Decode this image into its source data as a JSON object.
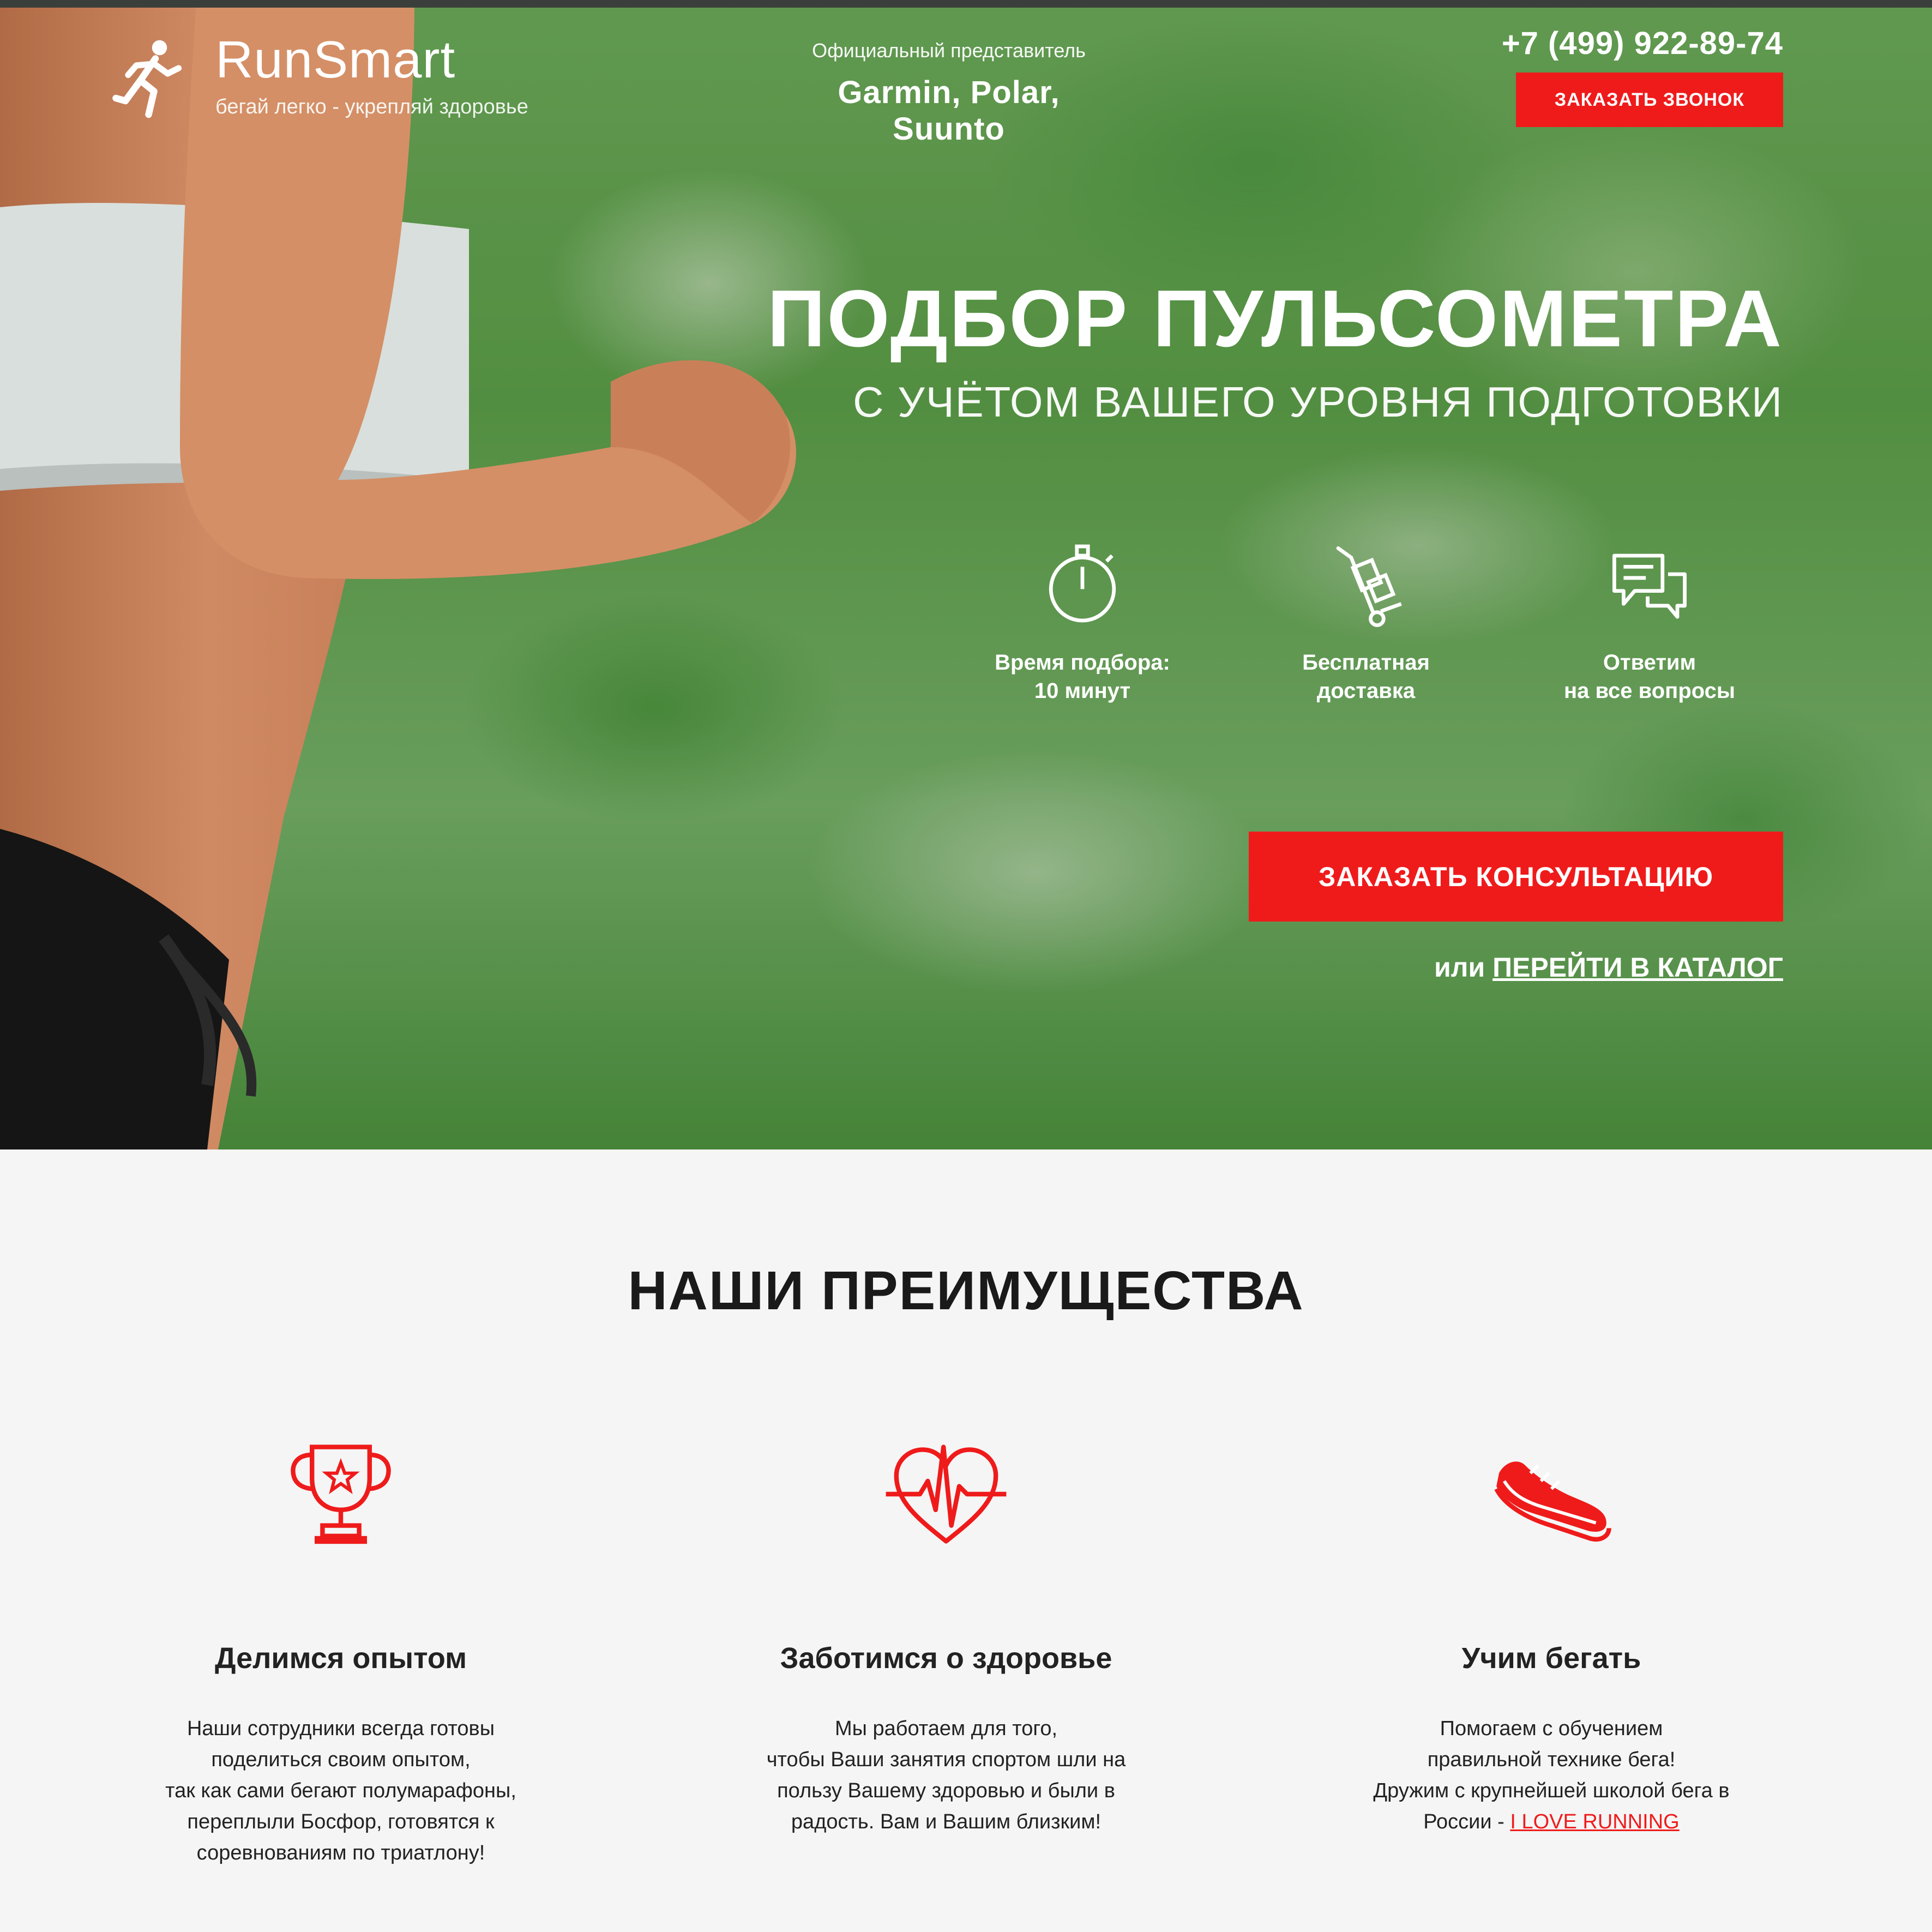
{
  "header": {
    "logo_name": "RunSmart",
    "logo_tagline": "бегай легко - укрепляй здоровье",
    "official_label": "Официальный представитель",
    "official_brands": "Garmin, Polar, Suunto",
    "phone": "+7 (499) 922-89-74",
    "callback_label": "Заказать звонок"
  },
  "hero": {
    "title": "ПОДБОР ПУЛЬСОМЕТРА",
    "subtitle": "С УЧЁТОМ ВАШЕГО УРОВНЯ ПОДГОТОВКИ",
    "features": [
      {
        "icon": "stopwatch-icon",
        "text": "Время подбора:\n10 минут"
      },
      {
        "icon": "delivery-cart-icon",
        "text": "Бесплатная\nдоставка"
      },
      {
        "icon": "chat-bubbles-icon",
        "text": "Ответим\nна все вопросы"
      }
    ],
    "consult_label": "Заказать консультацию",
    "or_text": "или ",
    "catalog_link": "ПЕРЕЙТИ В КАТАЛОГ"
  },
  "advantages": {
    "title": "НАШИ ПРЕИМУЩЕСТВА",
    "items": [
      {
        "icon": "trophy-icon",
        "heading": "Делимся опытом",
        "desc": "Наши сотрудники всегда готовы\nподелиться своим опытом,\nтак как сами бегают полумарафоны,\nпереплыли Босфор, готовятся к\nсоревнованиям по триатлону!"
      },
      {
        "icon": "heart-pulse-icon",
        "heading": "Заботимся о здоровье",
        "desc": "Мы работаем для того,\nчтобы Ваши занятия спортом шли на\nпользу Вашему здоровью и были в\nрадость. Вам и Вашим близким!"
      },
      {
        "icon": "sneaker-icon",
        "heading": "Учим бегать",
        "desc": "Помогаем с обучением\nправильной технике бега!\nДружим с крупнейшей школой бега в\nРоссии - ",
        "link": "I LOVE RUNNING"
      }
    ]
  },
  "colors": {
    "accent": "#ef1b1b",
    "hero_green": "#5ea24a",
    "section_bg": "#f5f5f5"
  }
}
